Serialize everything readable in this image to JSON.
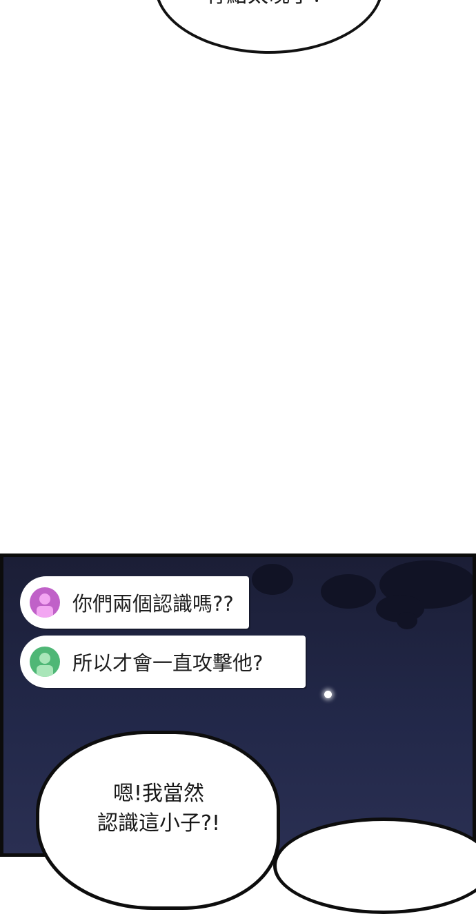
{
  "top_bubble": {
    "text": "有點太晚了？"
  },
  "chat": [
    {
      "text": "你們兩個認識嗎??",
      "avatar_color": "#c061c8",
      "avatar_light": "#f3a6f2"
    },
    {
      "text": "所以才會一直攻擊他?",
      "avatar_color": "#4fb776",
      "avatar_light": "#a9e6b9"
    }
  ],
  "speech": {
    "line1": "嗯!我當然",
    "line2": "認識這小子?!"
  },
  "colors": {
    "night_sky": "#222849",
    "panel_border": "#0c0c0c"
  }
}
